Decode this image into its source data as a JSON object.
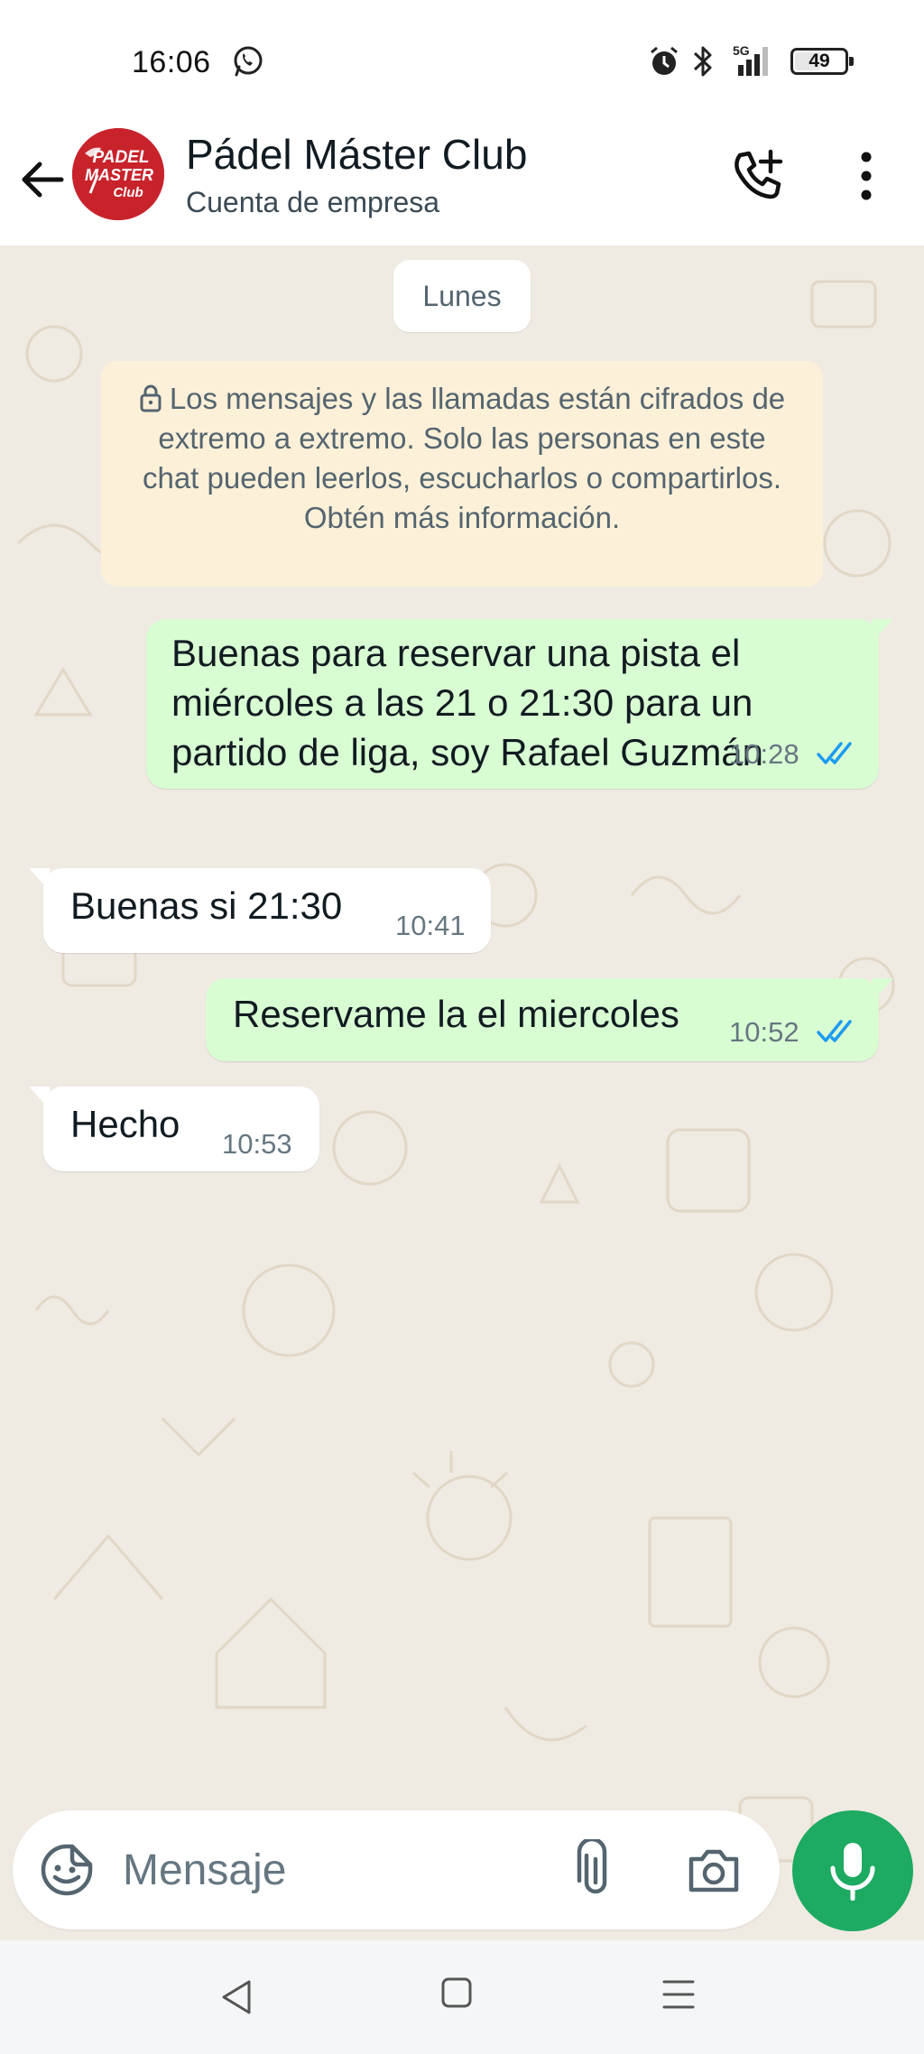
{
  "status_bar": {
    "time": "16:06",
    "battery": "49",
    "battery_level": 0.49,
    "network": "5G",
    "icons": [
      "whatsapp-icon",
      "alarm-icon",
      "bluetooth-icon",
      "signal-icon",
      "battery-icon"
    ]
  },
  "header": {
    "contact_name": "Pádel Máster Club",
    "subtitle": "Cuenta de empresa",
    "avatar_logo_lines": [
      "PADEL",
      "MASTER",
      "Club"
    ],
    "icons": [
      "back-arrow-icon",
      "add-call-icon",
      "more-vert-icon"
    ]
  },
  "chat": {
    "date_chip": "Lunes",
    "encryption_notice": "Los mensajes y las llamadas están cifrados de extremo a extremo. Solo las personas en este chat pueden leerlos, escucharlos o compartirlos. Obtén más información.",
    "messages": [
      {
        "direction": "outgoing",
        "lines": [
          "Buenas para reservar una pista el",
          "miércoles a las 21 o 21:30 para un",
          "partido de liga, soy Rafael Guzmán"
        ],
        "time": "10:28",
        "status": "read"
      },
      {
        "direction": "incoming",
        "text": "Buenas si 21:30",
        "time": "10:41"
      },
      {
        "direction": "outgoing",
        "text": "Reservame la el miercoles",
        "time": "10:52",
        "status": "read"
      },
      {
        "direction": "incoming",
        "text": "Hecho",
        "time": "10:53"
      }
    ]
  },
  "input": {
    "placeholder": "Mensaje",
    "icons": [
      "sticker-icon",
      "attach-icon",
      "camera-icon",
      "mic-icon"
    ]
  },
  "colors": {
    "outgoing_bubble": "#d9fdd3",
    "incoming_bubble": "#ffffff",
    "chat_background": "#efeae2",
    "notice_background": "#fdf0d8",
    "mic_button": "#1daa61",
    "read_ticks": "#1d9bf0",
    "avatar_red": "#c8232b"
  }
}
